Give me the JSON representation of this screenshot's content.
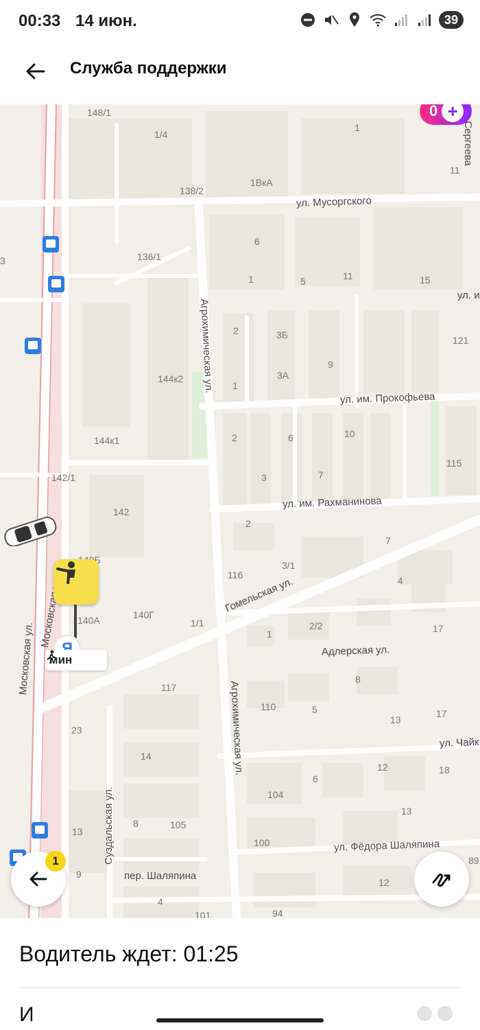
{
  "status_bar": {
    "time": "00:33",
    "date": "14 июн.",
    "battery": "39"
  },
  "header": {
    "title": "Служба поддержки",
    "back_icon": "arrow-left-icon"
  },
  "map": {
    "plus_badge": {
      "points": "0"
    },
    "house_numbers": [
      "148/1",
      "1/4",
      "138/2",
      "1ВкА",
      "1",
      "11",
      "6",
      "136/1",
      "1",
      "5",
      "11",
      "15",
      "2",
      "3Б",
      "9",
      "121",
      "1",
      "3А",
      "144к2",
      "2",
      "6",
      "10",
      "144к1",
      "3",
      "7",
      "115",
      "142/1",
      "142",
      "2",
      "7",
      "116",
      "3/1",
      "4",
      "140Б",
      "140А",
      "140Г",
      "1/1",
      "1",
      "2/2",
      "17",
      "8",
      "117",
      "110",
      "5",
      "17",
      "13",
      "23",
      "12",
      "18",
      "14",
      "6",
      "104",
      "13",
      "8",
      "105",
      "100",
      "12",
      "89",
      "13",
      "9",
      "4",
      "101",
      "94",
      "3"
    ],
    "streets": {
      "musorgskogo": "ул. Мусоргского",
      "prokofeva": "ул. им. Прокофьева",
      "rakhmaninova": "ул. им. Рахманинова",
      "gomelskaya": "Гомельская ул.",
      "adlerskaya": "Адлерская ул.",
      "chaykovskogo": "ул. Чайк",
      "shalyapina": "ул. Фёдора Шаляпина",
      "per_shalyapina": "пер. Шаляпина",
      "agrokhim_1": "Агрохимическая ул.",
      "agrokhim_2": "Агрохимическая ул.",
      "moskovskaya_1": "Московская ул.",
      "moskovskaya_2": "Московская ул.",
      "suzdalskaya": "Суздальская ул.",
      "edge_ul": "ул. и",
      "edge_sergeeva": "ул. Сергеева"
    },
    "walk_chip": {
      "text": "мин"
    },
    "ya_logo": "Я",
    "notification_count": "1"
  },
  "sheet": {
    "title": "Водитель ждет: 01:25",
    "partial_line": "И"
  },
  "colors": {
    "map_bg": "#f1efe8",
    "road": "#ffffff",
    "pin_yellow": "#f5df4d",
    "plus_gradient_start": "#ff2d7a",
    "plus_gradient_end": "#8a2bff"
  }
}
